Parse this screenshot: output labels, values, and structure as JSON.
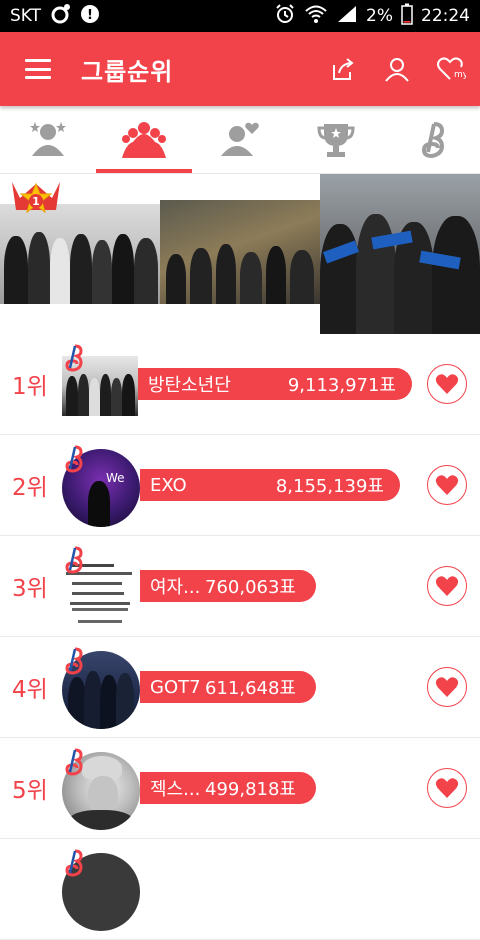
{
  "status_bar": {
    "carrier": "SKT",
    "battery": "2%",
    "time": "22:24"
  },
  "app_bar": {
    "title": "그룹순위"
  },
  "banner": {
    "first_place_badge": "1"
  },
  "thumb_text": {
    "exo": "We"
  },
  "rankings": [
    {
      "rank": "1위",
      "name": "방탄소년단",
      "votes": "9,113,971표"
    },
    {
      "rank": "2위",
      "name": "EXO",
      "votes": "8,155,139표"
    },
    {
      "rank": "3위",
      "name": "여자...",
      "votes": "760,063표"
    },
    {
      "rank": "4위",
      "name": "GOT7",
      "votes": "611,648표"
    },
    {
      "rank": "5위",
      "name": "젝스...",
      "votes": "499,818표"
    }
  ],
  "colors": {
    "brand": "#f2424a",
    "tab_icon": "#9e9e9e"
  }
}
